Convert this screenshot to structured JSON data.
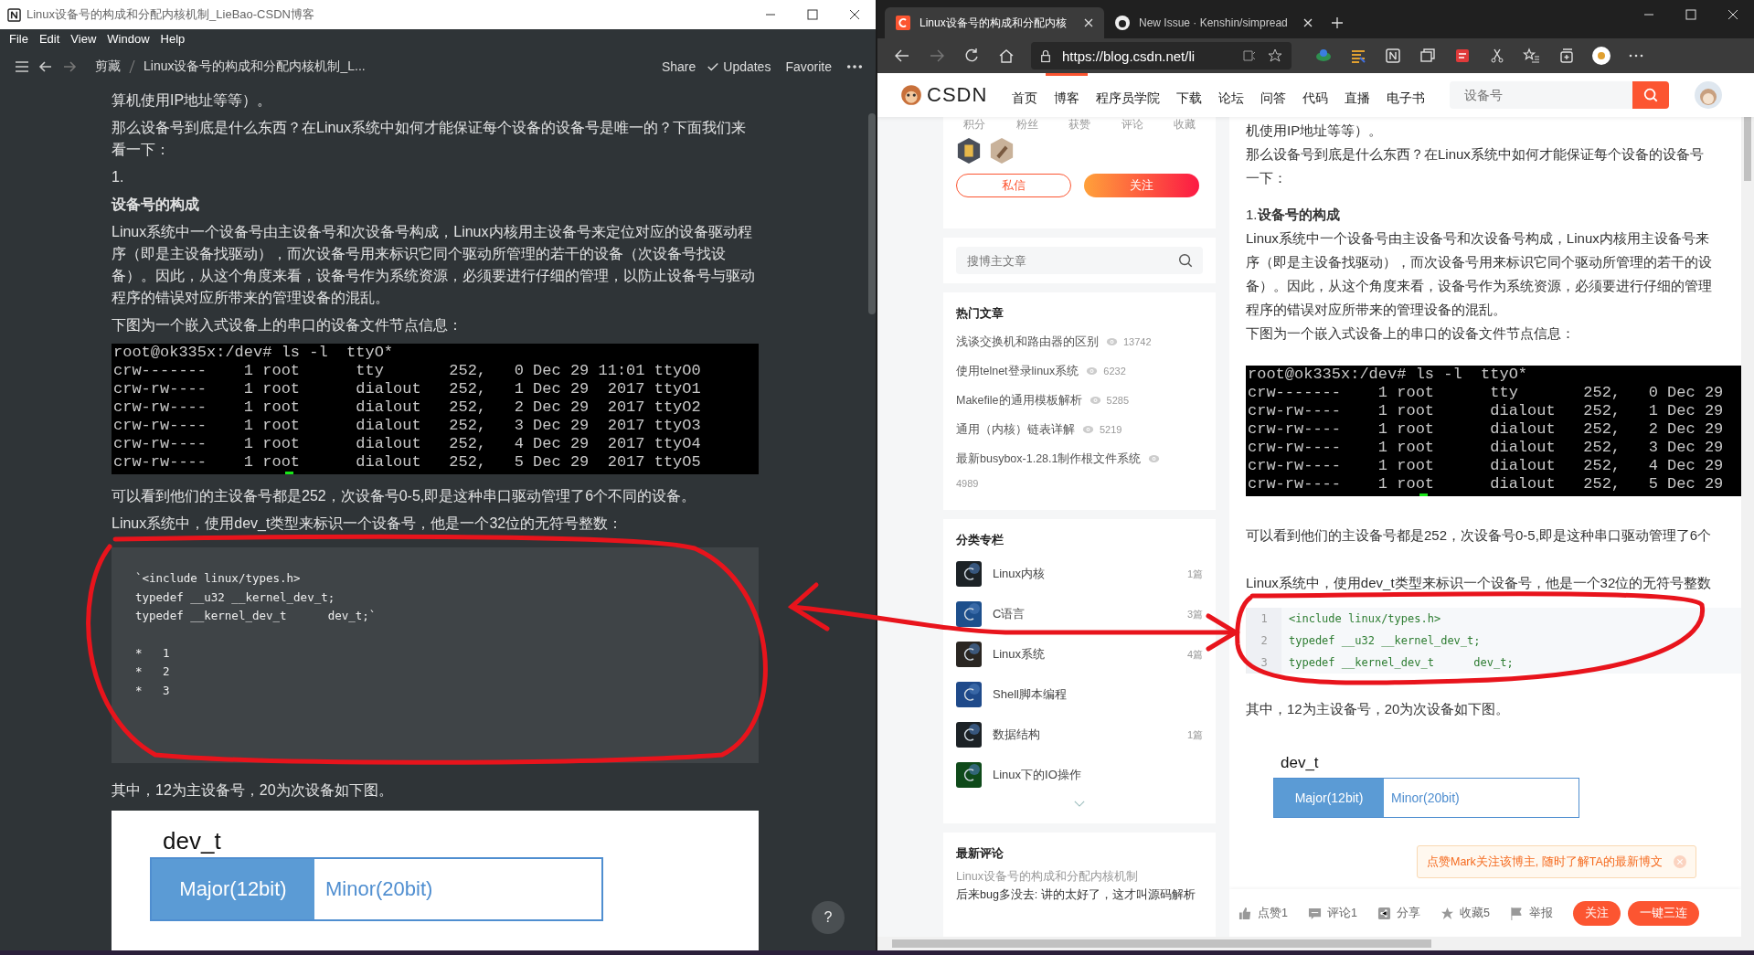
{
  "left_window": {
    "title": "Linux设备号的构成和分配内核机制_LieBao-CSDN博客",
    "menu": [
      "File",
      "Edit",
      "View",
      "Window",
      "Help"
    ],
    "breadcrumb": [
      "剪藏",
      "Linux设备号的构成和分配内核机制_L..."
    ],
    "actions": [
      "Share",
      "Updates",
      "Favorite"
    ],
    "help": "?",
    "blocks": [
      {
        "kind": "text",
        "text": "算机使用IP地址等等）。"
      },
      {
        "kind": "text",
        "text": "那么设备号到底是什么东西？在Linux系统中如何才能保证每个设备的设备号是唯一的？下面我们来看一下："
      },
      {
        "kind": "text",
        "text": "1."
      },
      {
        "kind": "heading",
        "text": "设备号的构成"
      },
      {
        "kind": "text",
        "text": "Linux系统中一个设备号由主设备号和次设备号构成，Linux内核用主设备号来定位对应的设备驱动程序（即是主设备找驱动），而次设备号用来标识它同个驱动所管理的若干的设备（次设备号找设备）。因此，从这个角度来看，设备号作为系统资源，必须要进行仔细的管理，以防止设备号与驱动程序的错误对应所带来的管理设备的混乱。"
      },
      {
        "kind": "text",
        "text": "下图为一个嵌入式设备上的串口的设备文件节点信息："
      },
      {
        "kind": "terminal",
        "lines": [
          "root@ok335x:/dev# ls -l  ttyO*",
          "crw-------    1 root      tty       252,   0 Dec 29 11:01 ttyO0",
          "crw-rw----    1 root      dialout   252,   1 Dec 29  2017 ttyO1",
          "crw-rw----    1 root      dialout   252,   2 Dec 29  2017 ttyO2",
          "crw-rw----    1 root      dialout   252,   3 Dec 29  2017 ttyO3",
          "crw-rw----    1 root      dialout   252,   4 Dec 29  2017 ttyO4",
          "crw-rw----    1 root      dialout   252,   5 Dec 29  2017 ttyO5"
        ]
      },
      {
        "kind": "text",
        "text": "可以看到他们的主设备号都是252，次设备号0-5,即是这种串口驱动管理了6个不同的设备。"
      },
      {
        "kind": "text",
        "text": "Linux系统中，使用dev_t类型来标识一个设备号，他是一个32位的无符号整数："
      },
      {
        "kind": "code",
        "lines": [
          "`<include linux/types.h>",
          "typedef __u32 __kernel_dev_t;",
          "typedef __kernel_dev_t      dev_t;`"
        ],
        "bullets": [
          "*   1",
          "*   2",
          "*   3"
        ]
      },
      {
        "kind": "text",
        "text": "其中，12为主设备号，20为次设备如下图。"
      },
      {
        "kind": "diagram",
        "title": "dev_t",
        "major": "Major(12bit)",
        "minor": "Minor(20bit)"
      }
    ]
  },
  "browser": {
    "tabs": [
      {
        "title": "Linux设备号的构成和分配内核",
        "selected": true
      },
      {
        "title": "New Issue · Kenshin/simpread",
        "selected": false
      }
    ],
    "url": "https://blog.csdn.net/li",
    "logo": "CSDN",
    "nav": [
      {
        "label": "首页",
        "selected": false
      },
      {
        "label": "博客",
        "selected": true
      },
      {
        "label": "程序员学院",
        "selected": false
      },
      {
        "label": "下载",
        "selected": false
      },
      {
        "label": "论坛",
        "selected": false
      },
      {
        "label": "问答",
        "selected": false
      },
      {
        "label": "代码",
        "selected": false
      },
      {
        "label": "直播",
        "selected": false
      },
      {
        "label": "电子书",
        "selected": false
      }
    ],
    "search": {
      "placeholder": "设备号"
    },
    "sidebar": {
      "stats": [
        "积分",
        "粉丝",
        "获赞",
        "评论",
        "收藏"
      ],
      "buttons": [
        "私信",
        "关注"
      ],
      "blog_search": {
        "placeholder": "搜博主文章"
      },
      "hot_title": "热门文章",
      "hot": [
        {
          "title": "浅谈交换机和路由器的区别",
          "views": "13742"
        },
        {
          "title": "使用telnet登录linux系统",
          "views": "6232"
        },
        {
          "title": "Makefile的通用模板解析",
          "views": "5285"
        },
        {
          "title": "通用（内核）链表详解",
          "views": "5219"
        },
        {
          "title": "最新busybox-1.28.1制作根文件系统",
          "views": "4989"
        }
      ],
      "cat_title": "分类专栏",
      "categories": [
        {
          "name": "Linux内核",
          "count": "1篇"
        },
        {
          "name": "C语言",
          "count": "3篇"
        },
        {
          "name": "Linux系统",
          "count": "4篇"
        },
        {
          "name": "Shell脚本编程"
        },
        {
          "name": "数据结构",
          "count": "1篇"
        },
        {
          "name": "Linux下的IO操作"
        }
      ],
      "comments_title": "最新评论",
      "comments": [
        {
          "article": "Linux设备号的构成和分配内核机制",
          "text": "后来bug多没去: 讲的太好了，这才叫源码解析"
        }
      ]
    },
    "article": [
      {
        "kind": "line",
        "text": "机使用IP地址等等）。"
      },
      {
        "kind": "line",
        "text": "那么设备号到底是什么东西？在Linux系统中如何才能保证每个设备的设备号"
      },
      {
        "kind": "line",
        "text": "一下："
      },
      {
        "kind": "heading",
        "text": "1.**设备号的构成**"
      },
      {
        "kind": "line",
        "text": "Linux系统中一个设备号由主设备号和次设备号构成，Linux内核用主设备号来"
      },
      {
        "kind": "line",
        "text": "序（即是主设备找驱动），而次设备号用来标识它同个驱动所管理的若干的设"
      },
      {
        "kind": "line",
        "text": "备）。因此，从这个角度来看，设备号作为系统资源，必须要进行仔细的管理"
      },
      {
        "kind": "line",
        "text": "程序的错误对应所带来的管理设备的混乱。"
      },
      {
        "kind": "line",
        "text": "下图为一个嵌入式设备上的串口的设备文件节点信息："
      },
      {
        "kind": "terminal",
        "lines": [
          "root@ok335x:/dev# ls -l  ttyO*",
          "crw-------    1 root      tty       252,   0 Dec 29",
          "crw-rw----    1 root      dialout   252,   1 Dec 29",
          "crw-rw----    1 root      dialout   252,   2 Dec 29",
          "crw-rw----    1 root      dialout   252,   3 Dec 29",
          "crw-rw----    1 root      dialout   252,   4 Dec 29",
          "crw-rw----    1 root      dialout   252,   5 Dec 29"
        ]
      },
      {
        "kind": "para",
        "text": "可以看到他们的主设备号都是252，次设备号0-5,即是这种串口驱动管理了6个"
      },
      {
        "kind": "para",
        "text": "Linux系统中，使用dev_t类型来标识一个设备号，他是一个32位的无符号整数"
      },
      {
        "kind": "numbered_code",
        "lines": [
          {
            "no": "1",
            "code": "<include linux/types.h>"
          },
          {
            "no": "2",
            "code": "typedef __u32 __kernel_dev_t;"
          },
          {
            "no": "3",
            "code": "typedef __kernel_dev_t      dev_t;"
          }
        ]
      },
      {
        "kind": "para",
        "text": "其中，12为主设备号，20为次设备如下图。"
      },
      {
        "kind": "diagram",
        "title": "dev_t",
        "major": "Major(12bit)",
        "minor": "Minor(20bit)"
      }
    ],
    "toast": "点赞Mark关注该博主, 随时了解TA的最新博文",
    "bottom_actions": [
      "点赞1",
      "评论1",
      "分享",
      "收藏5",
      "举报"
    ],
    "bottom_buttons": [
      "关注",
      "一键三连"
    ]
  }
}
